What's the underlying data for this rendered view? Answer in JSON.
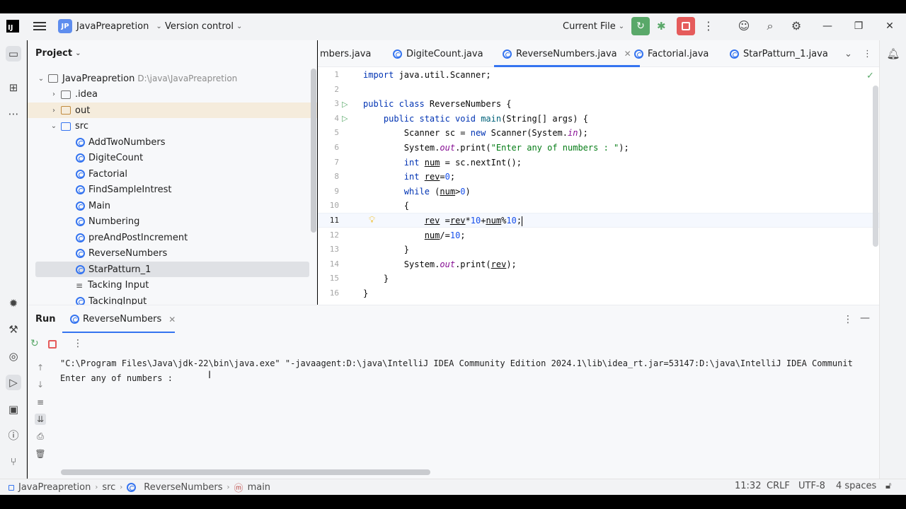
{
  "titlebar": {
    "logo": "IJ",
    "project_badge": "JP",
    "project_name": "JavaPreapretion",
    "version_control": "Version control",
    "run_config": "Current File"
  },
  "project_panel": {
    "title": "Project",
    "root": {
      "label": "JavaPreapretion",
      "path": "D:\\java\\JavaPreapretion"
    },
    "items": [
      {
        "label": ".idea",
        "kind": "folder"
      },
      {
        "label": "out",
        "kind": "folder"
      },
      {
        "label": "src",
        "kind": "folder"
      },
      {
        "label": "AddTwoNumbers",
        "kind": "class"
      },
      {
        "label": "DigiteCount",
        "kind": "class"
      },
      {
        "label": "Factorial",
        "kind": "class"
      },
      {
        "label": "FindSampleIntrest",
        "kind": "class"
      },
      {
        "label": "Main",
        "kind": "class"
      },
      {
        "label": "Numbering",
        "kind": "class"
      },
      {
        "label": "preAndPostIncrement",
        "kind": "class"
      },
      {
        "label": "ReverseNumbers",
        "kind": "class"
      },
      {
        "label": "StarPatturn_1",
        "kind": "class"
      },
      {
        "label": "Tacking Input",
        "kind": "text"
      },
      {
        "label": "TackingInput",
        "kind": "class"
      }
    ]
  },
  "editor": {
    "tabs": [
      {
        "label": "mbers.java"
      },
      {
        "label": "DigiteCount.java"
      },
      {
        "label": "ReverseNumbers.java"
      },
      {
        "label": "Factorial.java"
      },
      {
        "label": "StarPatturn_1.java"
      }
    ],
    "line_numbers": [
      "1",
      "2",
      "3",
      "4",
      "5",
      "6",
      "7",
      "8",
      "9",
      "10",
      "11",
      "12",
      "13",
      "14",
      "15",
      "16"
    ],
    "current_line": "11"
  },
  "run_panel": {
    "title": "Run",
    "tab": "ReverseNumbers",
    "console": [
      "\"C:\\Program Files\\Java\\jdk-22\\bin\\java.exe\" \"-javaagent:D:\\java\\IntelliJ IDEA Community Edition 2024.1\\lib\\idea_rt.jar=53147:D:\\java\\IntelliJ IDEA Communit",
      "Enter any of numbers : "
    ]
  },
  "statusbar": {
    "crumbs": [
      "JavaPreapretion",
      "src",
      "ReverseNumbers",
      "main"
    ],
    "position": "11:32",
    "line_sep": "CRLF",
    "encoding": "UTF-8",
    "indent": "4 spaces"
  }
}
